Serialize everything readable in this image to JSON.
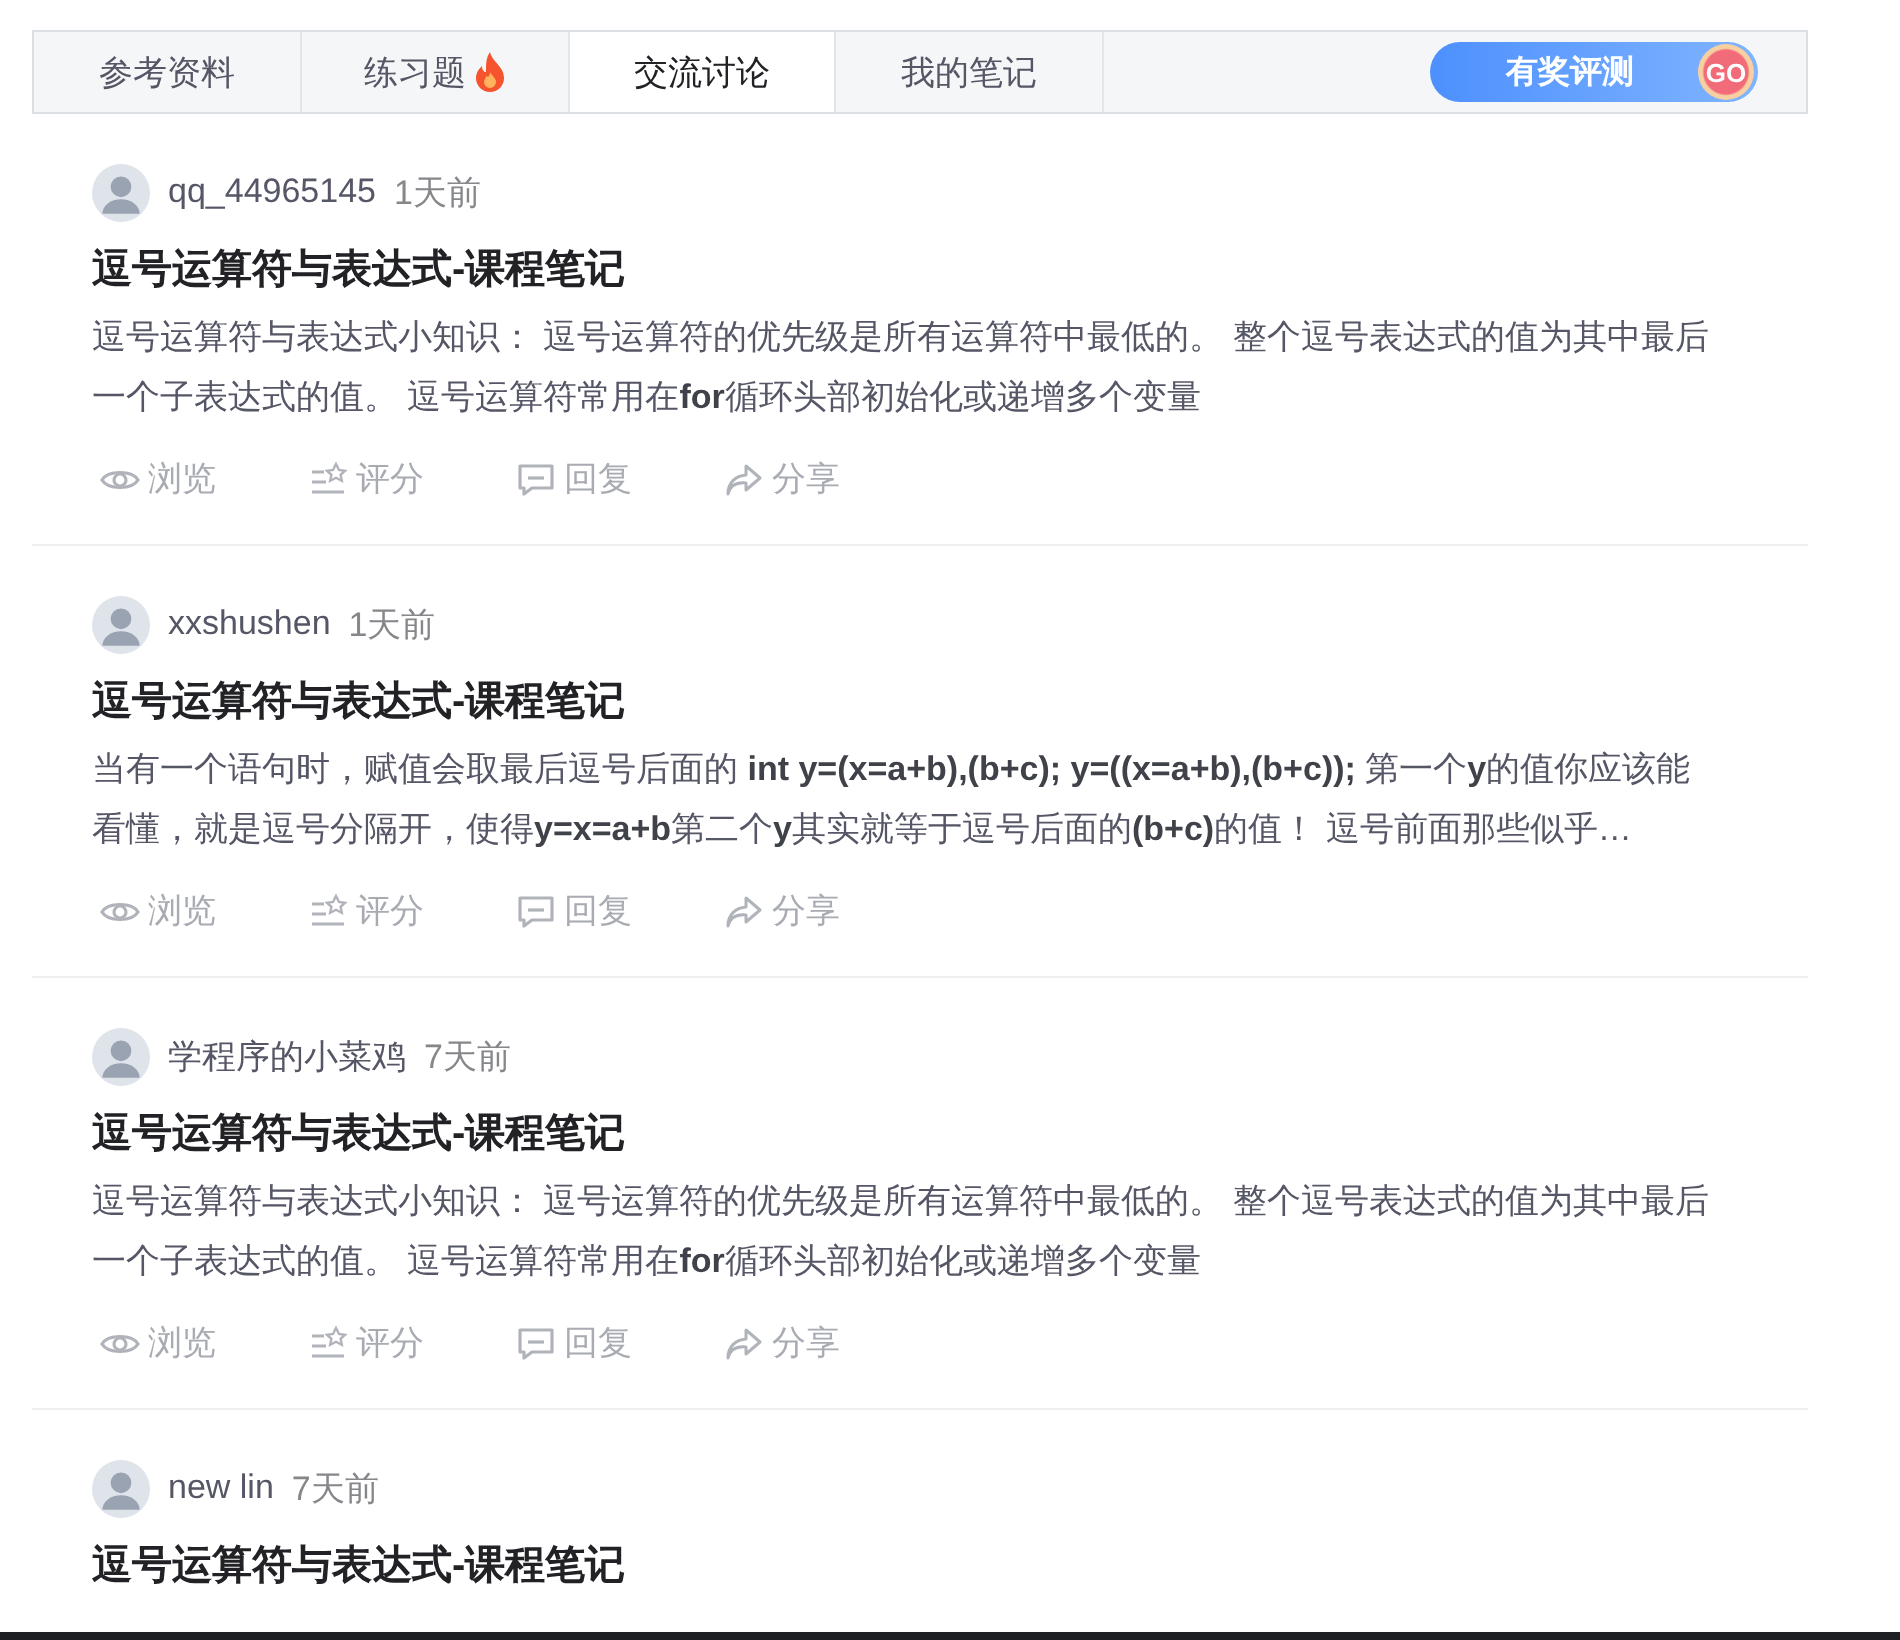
{
  "tabs": [
    {
      "label": "参考资料",
      "selected": false,
      "hot": false
    },
    {
      "label": "练习题",
      "selected": false,
      "hot": true
    },
    {
      "label": "交流讨论",
      "selected": true,
      "hot": false
    },
    {
      "label": "我的笔记",
      "selected": false,
      "hot": false
    }
  ],
  "promo_button": {
    "label": "有奖评测",
    "badge": "GO"
  },
  "posts": [
    {
      "author": "qq_44965145",
      "time": "1天前",
      "title": "逗号运算符与表达式-课程笔记",
      "body": "逗号运算符与表达式小知识： 逗号运算符的优先级是所有运算符中最低的。 整个逗号表达式的值为其中最后一个子表达式的值。 逗号运算符常用在**for**循环头部初始化或递增多个变量",
      "actions": [
        "浏览",
        "评分",
        "回复",
        "分享"
      ]
    },
    {
      "author": "xxshushen",
      "time": "1天前",
      "title": "逗号运算符与表达式-课程笔记",
      "body": "当有一个语句时，赋值会取最后逗号后面的 **int y=(x=a+b),(b+c); y=((x=a+b),(b+c));** 第一个**y**的值你应该能看懂，就是逗号分隔开，使得**y=x=a+b**第二个**y**其实就等于逗号后面的**(b+c)**的值！ 逗号前面那些似乎…",
      "actions": [
        "浏览",
        "评分",
        "回复",
        "分享"
      ]
    },
    {
      "author": "学程序的小菜鸡",
      "time": "7天前",
      "title": "逗号运算符与表达式-课程笔记",
      "body": "逗号运算符与表达式小知识： 逗号运算符的优先级是所有运算符中最低的。 整个逗号表达式的值为其中最后一个子表达式的值。 逗号运算符常用在**for**循环头部初始化或递增多个变量",
      "actions": [
        "浏览",
        "评分",
        "回复",
        "分享"
      ]
    },
    {
      "author": "new lin",
      "time": "7天前",
      "title": "逗号运算符与表达式-课程笔记"
    }
  ]
}
